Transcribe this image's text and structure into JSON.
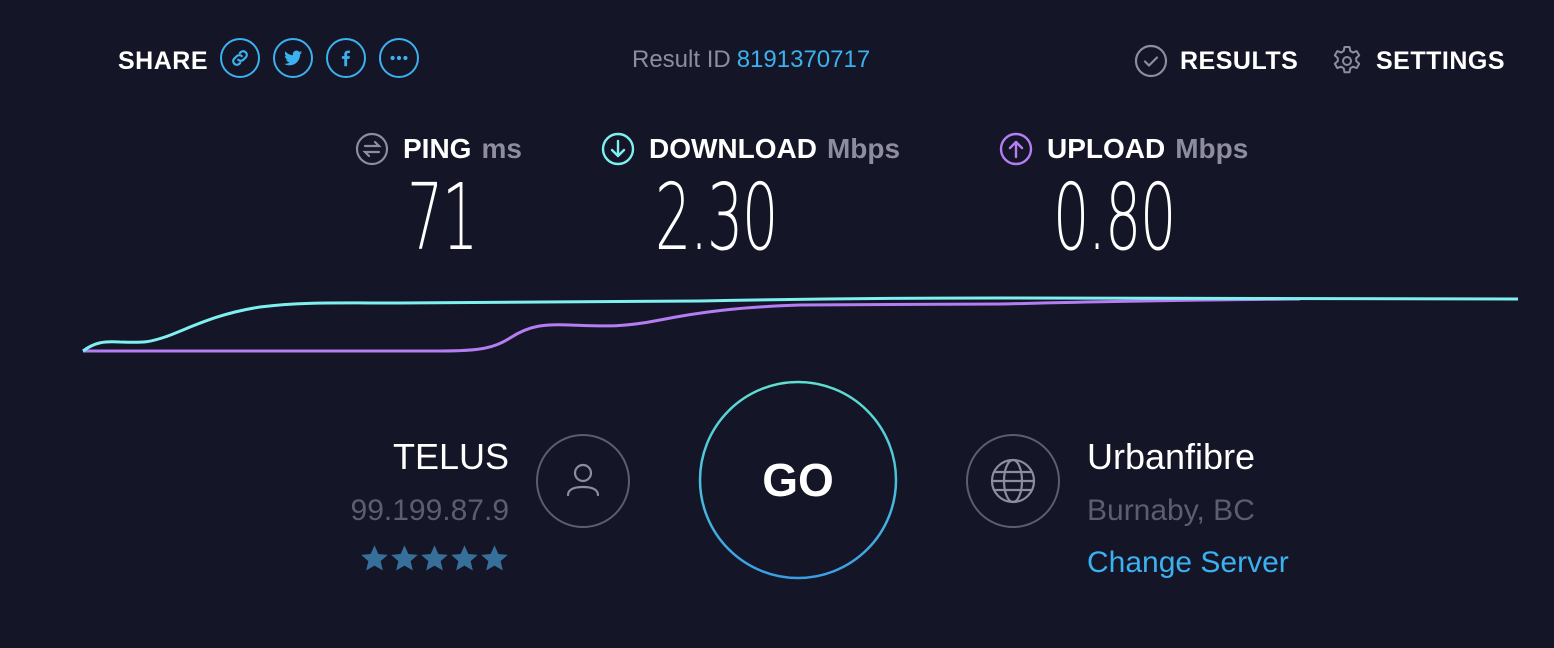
{
  "header": {
    "share_label": "SHARE",
    "share_buttons": [
      {
        "name": "link-icon",
        "label": "Copy link"
      },
      {
        "name": "twitter-icon",
        "label": "Twitter"
      },
      {
        "name": "facebook-icon",
        "label": "Facebook"
      },
      {
        "name": "more-icon",
        "label": "More"
      }
    ],
    "result_id_label": "Result ID",
    "result_id_value": "8191370717",
    "results_label": "RESULTS",
    "settings_label": "SETTINGS"
  },
  "metrics": {
    "ping": {
      "label": "PING",
      "unit": "ms",
      "value": "71",
      "icon": "ping-icon"
    },
    "download": {
      "label": "DOWNLOAD",
      "unit": "Mbps",
      "value": "2.30",
      "icon": "download-arrow-icon"
    },
    "upload": {
      "label": "UPLOAD",
      "unit": "Mbps",
      "value": "0.80",
      "icon": "upload-arrow-icon"
    }
  },
  "graph": {
    "download_color": "#7ff0f0",
    "upload_color": "#b57df2"
  },
  "isp": {
    "name": "TELUS",
    "ip": "99.199.87.9",
    "rating": 5,
    "rating_max": 5,
    "star_color": "#376f9b"
  },
  "go_label": "GO",
  "server": {
    "name": "Urbanfibre",
    "location": "Burnaby, BC",
    "change_label": "Change Server"
  },
  "colors": {
    "background": "#141526",
    "accent_blue": "#3bb1ef",
    "muted": "#8d8d9f",
    "dim": "#5c5d6e"
  }
}
